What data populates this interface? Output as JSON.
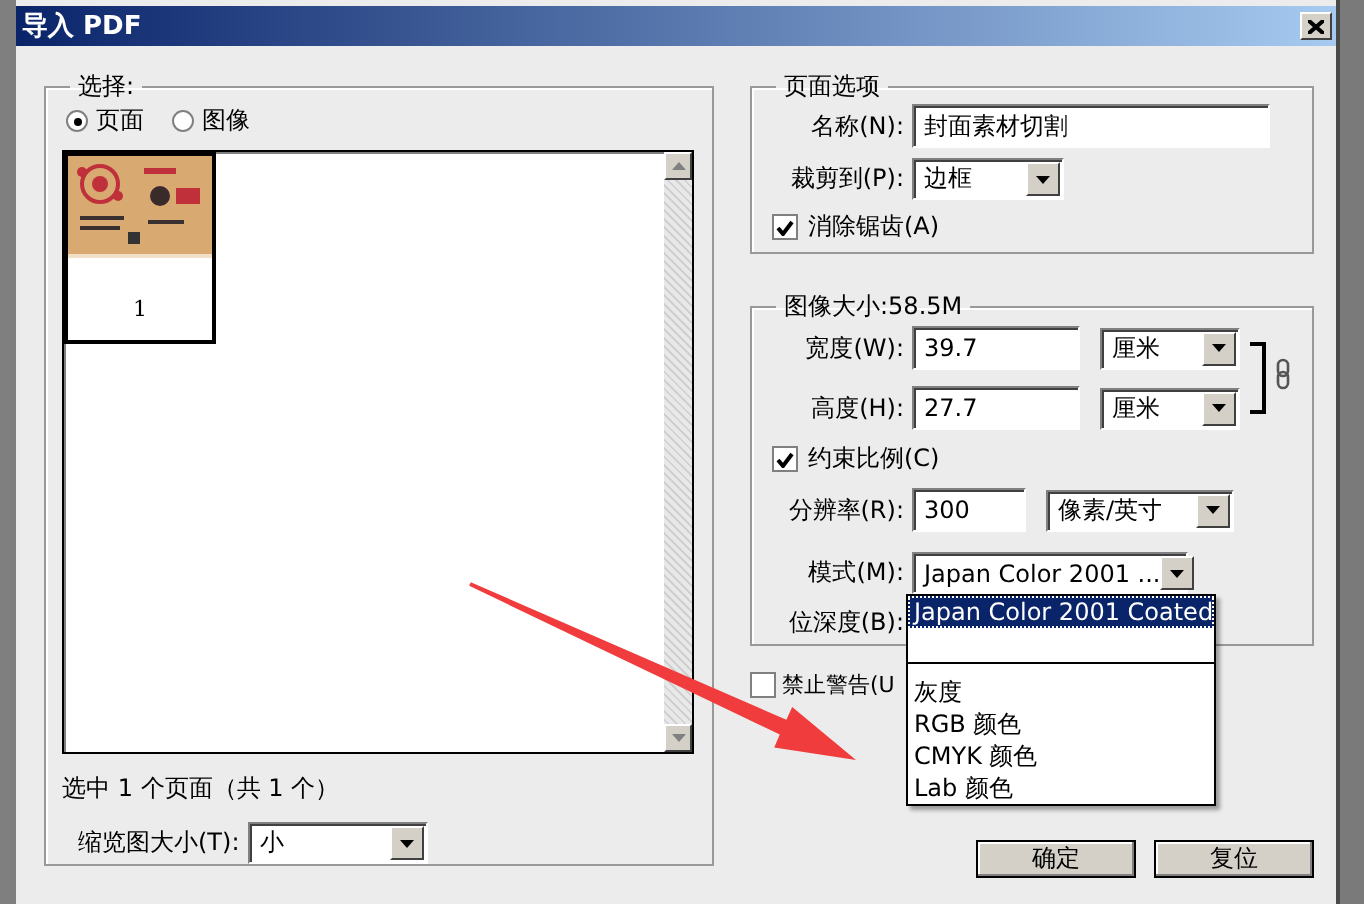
{
  "window": {
    "title": "导入 PDF"
  },
  "selection": {
    "legend": "选择:",
    "options": [
      {
        "label": "页面",
        "selected": true
      },
      {
        "label": "图像",
        "selected": false
      }
    ],
    "pages": [
      {
        "number": "1",
        "selected": true
      }
    ],
    "summary": "选中 1 个页面（共 1 个）",
    "thumbnail_size": {
      "label": "缩览图大小(T):",
      "value": "小"
    }
  },
  "page_options": {
    "legend": "页面选项",
    "name": {
      "label": "名称(N):",
      "value": "封面素材切割"
    },
    "crop": {
      "label": "裁剪到(P):",
      "value": "边框"
    },
    "antialias": {
      "label": "消除锯齿(A)",
      "checked": true
    }
  },
  "image_size": {
    "legend": "图像大小:58.5M",
    "width": {
      "label": "宽度(W):",
      "value": "39.7",
      "unit": "厘米"
    },
    "height": {
      "label": "高度(H):",
      "value": "27.7",
      "unit": "厘米"
    },
    "constrain": {
      "label": "约束比例(C)",
      "checked": true
    },
    "resolution": {
      "label": "分辨率(R):",
      "value": "300",
      "unit": "像素/英寸"
    },
    "mode": {
      "label": "模式(M):",
      "value": "Japan Color 2001 ..."
    },
    "bit_depth": {
      "label": "位深度(B):"
    }
  },
  "mode_menu": [
    {
      "kind": "option",
      "label": "Japan Color 2001 Coated",
      "selected": true
    },
    {
      "kind": "blank",
      "selected": false
    },
    {
      "kind": "separator"
    },
    {
      "kind": "option",
      "label": "灰度",
      "selected": false
    },
    {
      "kind": "option",
      "label": "RGB 颜色",
      "selected": false
    },
    {
      "kind": "option",
      "label": "CMYK 颜色",
      "selected": false
    },
    {
      "kind": "option",
      "label": "Lab 颜色",
      "selected": false
    }
  ],
  "suppress_warnings": {
    "label": "禁止警告(U",
    "checked": false
  },
  "buttons": [
    {
      "label": "确定"
    },
    {
      "label": "复位"
    }
  ]
}
